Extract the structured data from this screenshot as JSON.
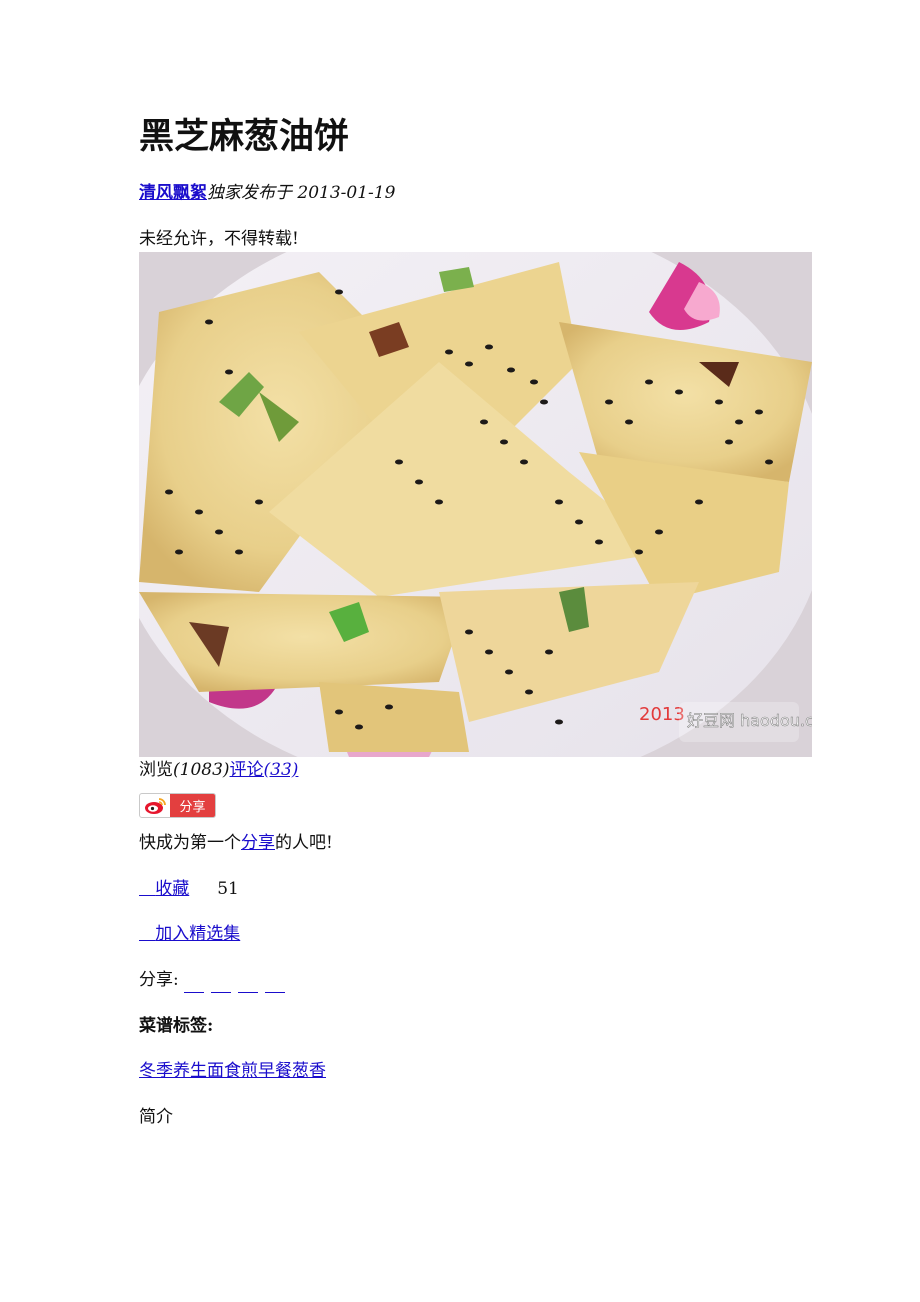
{
  "recipe": {
    "title": "黑芝麻葱油饼",
    "author": "清风飘絮",
    "published": "独家发布于 2013-01-19",
    "notice": "未经允许，不得转载!",
    "photo_watermark": "好豆网 haodou.com",
    "photo_date_stamp": "2013"
  },
  "stats": {
    "views_label": "浏览",
    "views_count": "(1083)",
    "comments_label": "评论",
    "comments_count": "(33)"
  },
  "share": {
    "button_label": "分享",
    "first_prefix": "快成为第一个",
    "first_link": "分享",
    "first_suffix": "的人吧!",
    "favorite_label": "收藏",
    "favorite_count": "51",
    "add_collection_label": "加入精选集",
    "share_to_label": "分享:"
  },
  "tags": {
    "label": "菜谱标签:",
    "items": [
      "冬季养生",
      "面食",
      "煎",
      "早餐",
      "葱香"
    ]
  },
  "intro": {
    "label": "简介"
  },
  "colors": {
    "link": "#1a0dcc",
    "share_red": "#e33f3f"
  }
}
